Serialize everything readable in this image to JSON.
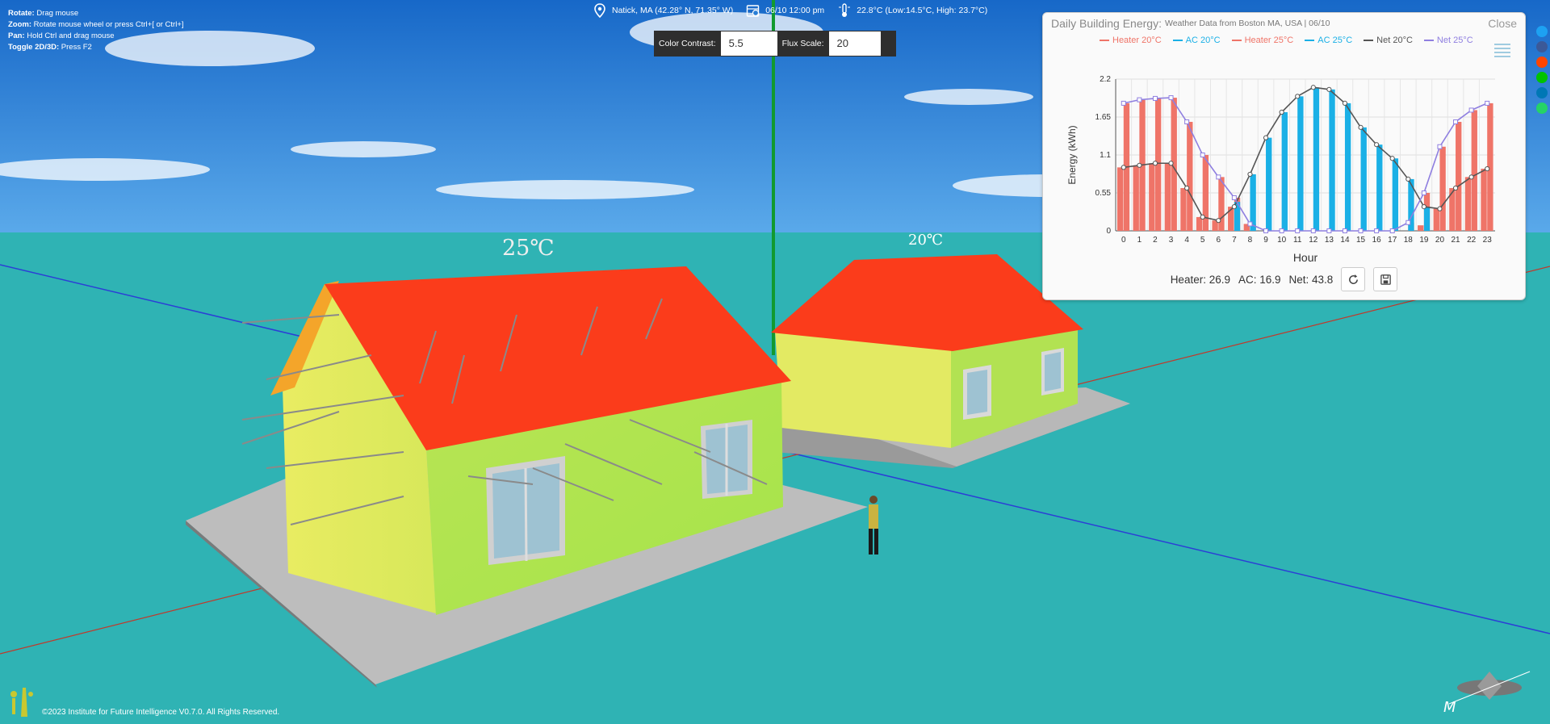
{
  "help": {
    "rotate_label": "Rotate:",
    "rotate_text": " Drag mouse",
    "zoom_label": "Zoom:",
    "zoom_text": " Rotate mouse wheel or press Ctrl+[ or Ctrl+]",
    "pan_label": "Pan:",
    "pan_text": " Hold Ctrl and drag mouse",
    "toggle_label": "Toggle 2D/3D:",
    "toggle_text": " Press F2"
  },
  "weather": {
    "location": "Natick, MA (42.28° N, 71.35° W)",
    "datetime": "06/10 12:00 pm",
    "temperature": "22.8°C (Low:14.5°C, High: 23.7°C)"
  },
  "controls": {
    "contrast_label": "Color Contrast:",
    "contrast_value": "5.5",
    "flux_label": "Flux Scale:",
    "flux_value": "20"
  },
  "scene": {
    "label_left": "25℃",
    "label_right": "20℃"
  },
  "panel": {
    "title": "Daily Building Energy:",
    "subtitle": "Weather Data from Boston MA, USA | 06/10",
    "close": "Close",
    "summary_heater": "Heater: 26.9",
    "summary_ac": "AC: 16.9",
    "summary_net": "Net: 43.8"
  },
  "footer": {
    "copyright": "©2023 Institute for Future Intelligence V0.7.0. All Rights Reserved."
  },
  "colors": {
    "heater": "#ef7468",
    "ac": "#1ab0e6",
    "net20": "#555555",
    "net25": "#8f7fe0"
  },
  "chart_data": {
    "type": "bar",
    "xlabel": "Hour",
    "ylabel": "Energy (kWh)",
    "ylim": [
      0,
      2.2
    ],
    "yticks": [
      "0",
      "0.55",
      "1.1",
      "1.65",
      "2.2"
    ],
    "categories": [
      "0",
      "1",
      "2",
      "3",
      "4",
      "5",
      "6",
      "7",
      "8",
      "9",
      "10",
      "11",
      "12",
      "13",
      "14",
      "15",
      "16",
      "17",
      "18",
      "19",
      "20",
      "21",
      "22",
      "23"
    ],
    "legend": [
      "Heater 20°C",
      "AC 20°C",
      "Heater 25°C",
      "AC 25°C",
      "Net 20°C",
      "Net 25°C"
    ],
    "series": [
      {
        "name": "Heater 20°C",
        "values": [
          0.92,
          0.95,
          0.98,
          0.98,
          0.62,
          0.2,
          0.15,
          0.35,
          0.1,
          0,
          0,
          0,
          0,
          0,
          0,
          0,
          0,
          0,
          0,
          0.08,
          0.32,
          0.62,
          0.78,
          0.9
        ]
      },
      {
        "name": "AC 20°C",
        "values": [
          0,
          0,
          0,
          0,
          0,
          0,
          0,
          0,
          0,
          0,
          0,
          0,
          0,
          0,
          0,
          0,
          0,
          0,
          0,
          0,
          0,
          0,
          0,
          0
        ]
      },
      {
        "name": "Heater 25°C",
        "values": [
          1.85,
          1.9,
          1.92,
          1.93,
          1.58,
          1.1,
          0.78,
          0.48,
          0.1,
          0,
          0,
          0,
          0,
          0,
          0,
          0,
          0,
          0,
          0.12,
          0.55,
          1.22,
          1.58,
          1.75,
          1.85
        ]
      },
      {
        "name": "AC 25°C",
        "values": [
          0,
          0,
          0,
          0,
          0,
          0,
          0,
          0.42,
          0.82,
          1.35,
          1.72,
          1.95,
          2.08,
          2.05,
          1.85,
          1.5,
          1.25,
          1.05,
          0.75,
          0.35,
          0,
          0,
          0,
          0
        ]
      },
      {
        "name": "Net 20°C",
        "values": [
          0.92,
          0.95,
          0.98,
          0.98,
          0.62,
          0.2,
          0.15,
          0.35,
          0.82,
          1.35,
          1.72,
          1.95,
          2.08,
          2.05,
          1.85,
          1.5,
          1.25,
          1.05,
          0.75,
          0.35,
          0.32,
          0.62,
          0.78,
          0.9
        ]
      },
      {
        "name": "Net 25°C",
        "values": [
          1.85,
          1.9,
          1.92,
          1.93,
          1.58,
          1.1,
          0.78,
          0.48,
          0.1,
          0,
          0,
          0,
          0,
          0,
          0,
          0,
          0,
          0,
          0.12,
          0.55,
          1.22,
          1.58,
          1.75,
          1.85
        ]
      }
    ]
  }
}
